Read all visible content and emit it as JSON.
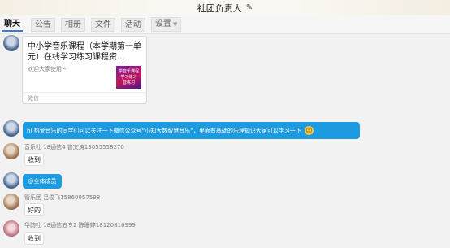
{
  "window": {
    "title": "社团负责人",
    "edit_icon": "pencil-icon"
  },
  "tabs": [
    {
      "label": "聊天",
      "active": true
    },
    {
      "label": "公告"
    },
    {
      "label": "相册"
    },
    {
      "label": "文件"
    },
    {
      "label": "活动"
    },
    {
      "label": "设置",
      "has_dropdown": true
    }
  ],
  "messages": [
    {
      "type": "card",
      "title": "中小学音乐课程（本学期第一单元）在线学习练习课程资...",
      "description": "欢迎大家使用~",
      "thumb_lines": [
        "学音乐课程",
        "学习练习",
        "音练习"
      ],
      "source": "微信"
    },
    {
      "type": "text",
      "text": "hi 热爱音乐的同学们可以关注一下微信公众号“小知大数智慧音乐”，里面有基础的乐理知识大家可以学习一下",
      "emoji": "smile-emoji"
    },
    {
      "type": "text",
      "sender": "音乐社 18通信4 曾文涛13055558270",
      "text": "收到"
    },
    {
      "type": "text",
      "text": "@全体成员"
    },
    {
      "type": "text",
      "sender": "管乐团 吕俊飞15860957598",
      "text": "好的"
    },
    {
      "type": "text",
      "sender": "华韵社 18通信五专2 陈珊婷18120816999",
      "text": "收到"
    }
  ],
  "colors": {
    "accent_blue": "#1d9be0",
    "tab_underline": "#3a7bd5",
    "background": "#f2f2f2"
  }
}
